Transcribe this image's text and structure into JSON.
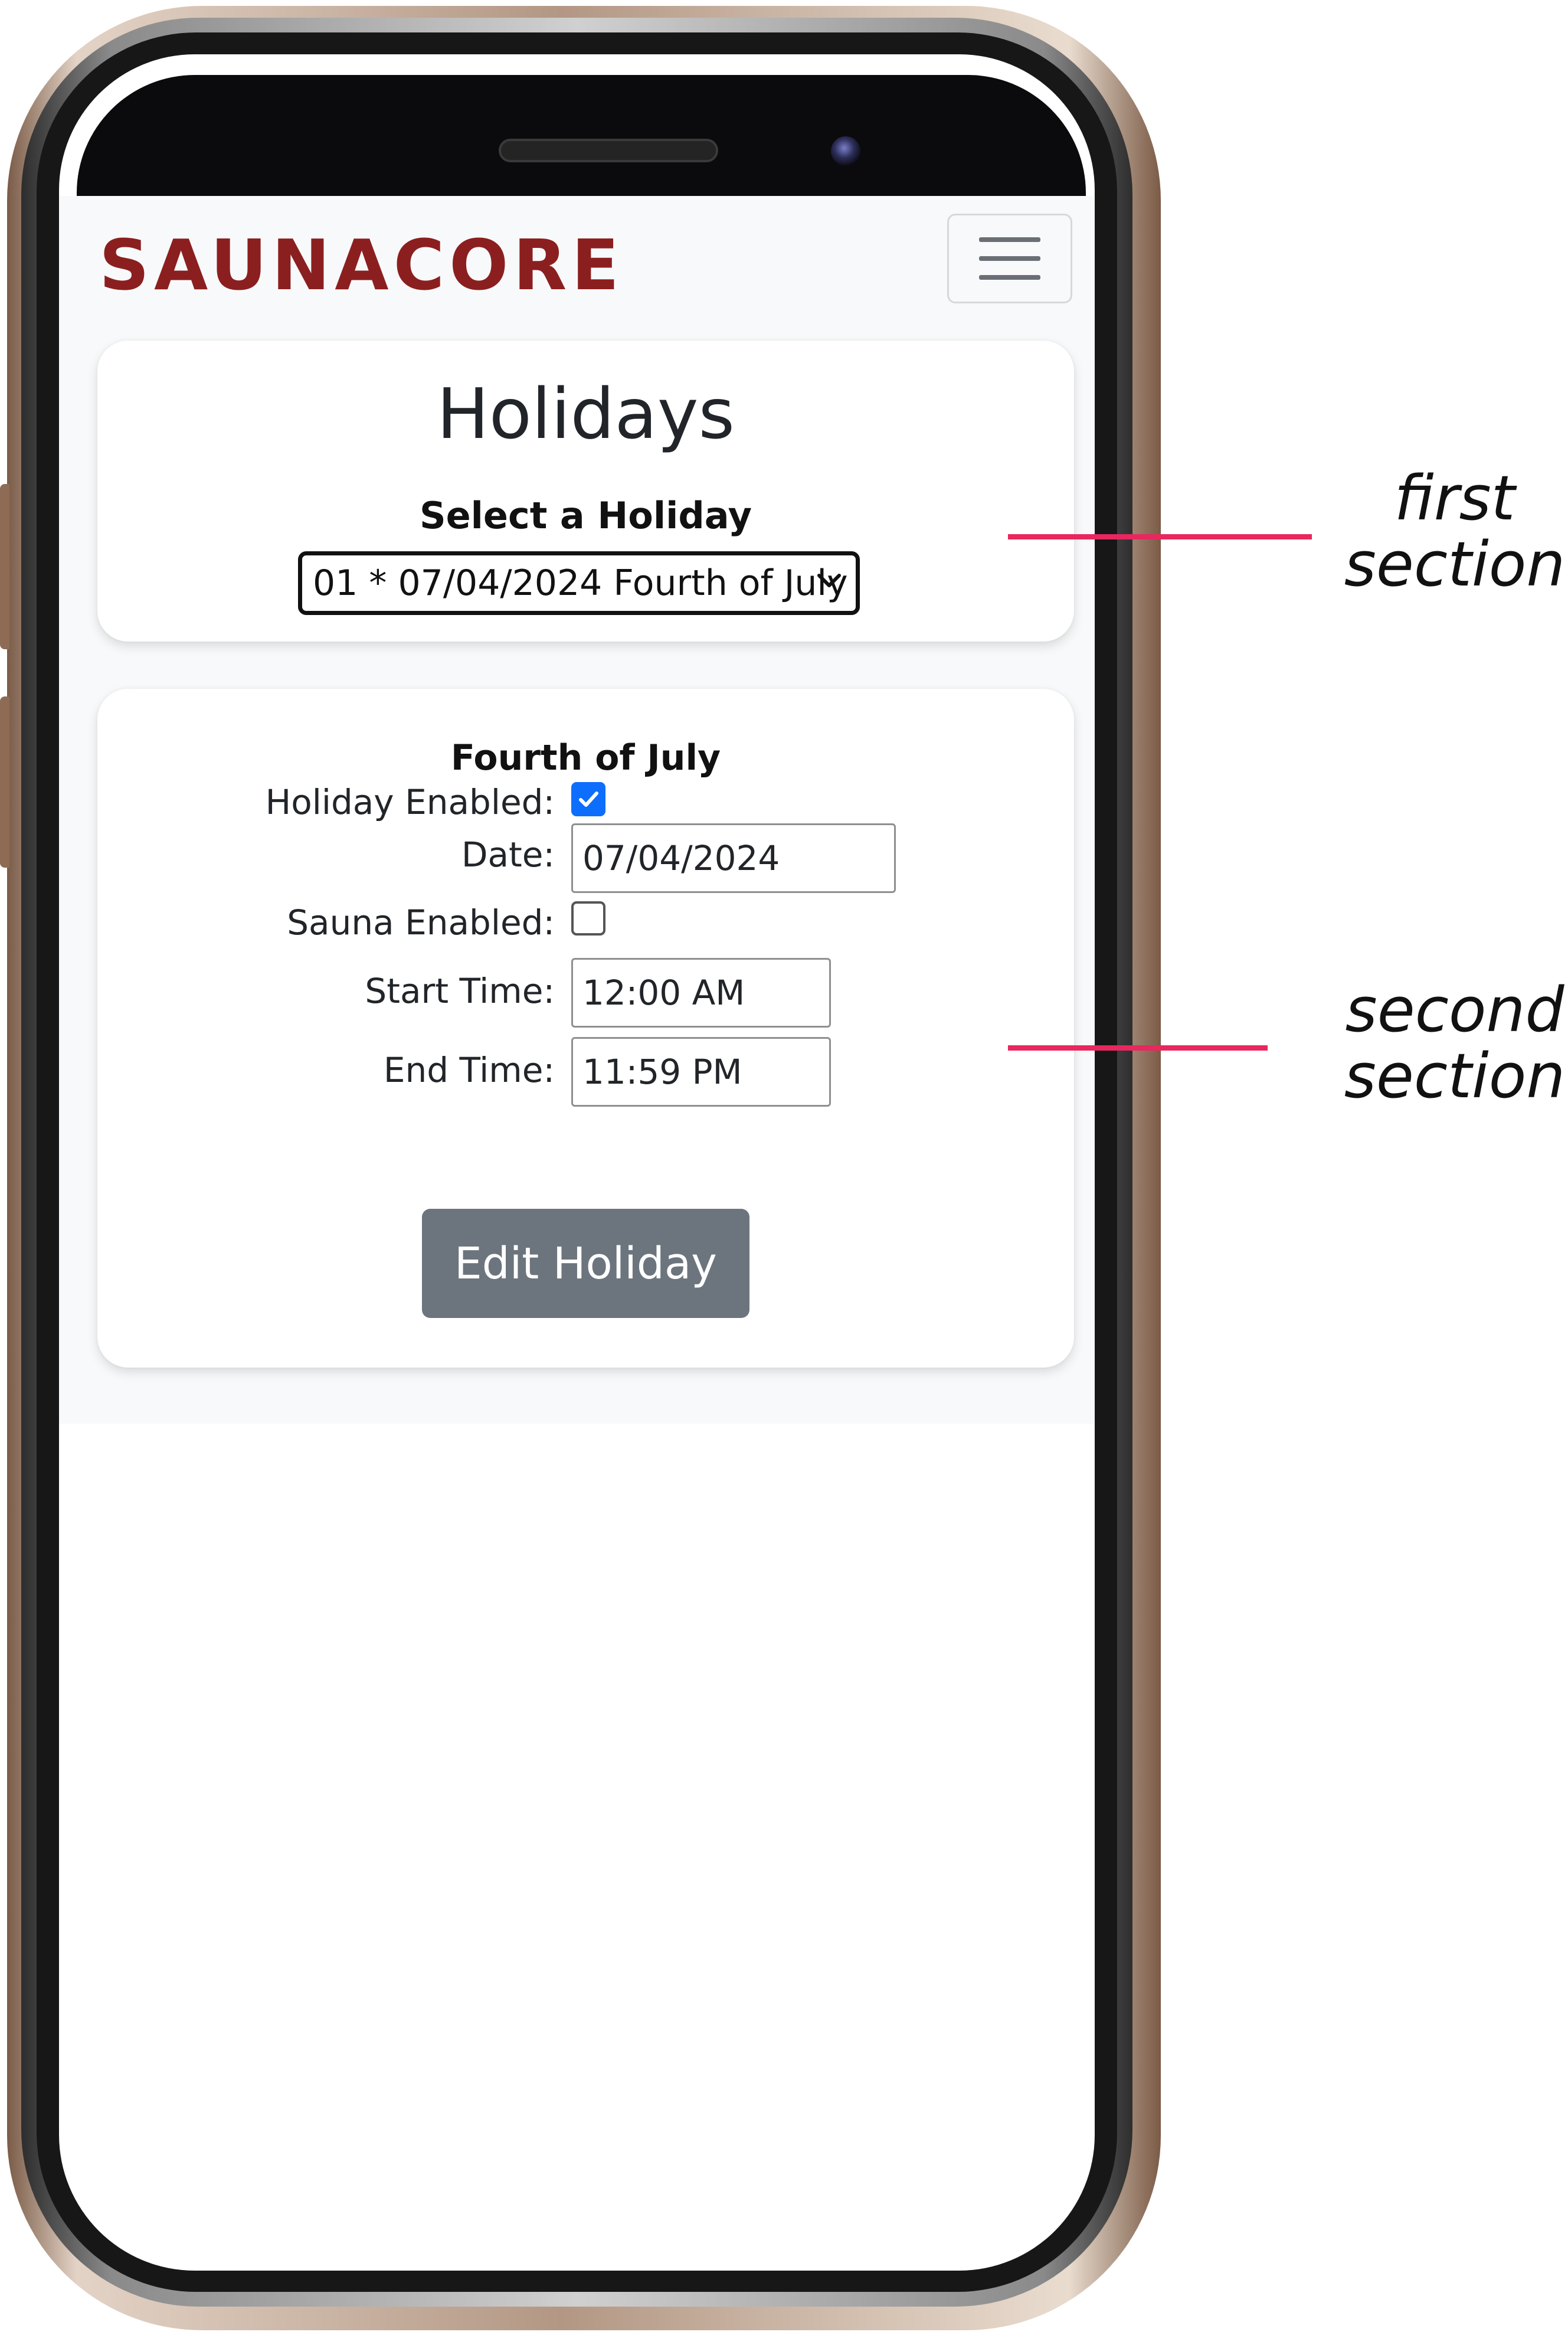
{
  "app": {
    "brand": "SAUNACORE",
    "brand_color": "#8b1f1f",
    "menu_icon": "hamburger-menu-icon"
  },
  "first_section": {
    "title": "Holidays",
    "select_label": "Select a Holiday",
    "selected_holiday": "01 * 07/04/2024 Fourth of July"
  },
  "second_section": {
    "holiday_name": "Fourth of July",
    "fields": {
      "holiday_enabled": {
        "label": "Holiday Enabled:",
        "checked": true
      },
      "date": {
        "label": "Date:",
        "value": "07/04/2024"
      },
      "sauna_enabled": {
        "label": "Sauna Enabled:",
        "checked": false
      },
      "start_time": {
        "label": "Start Time:",
        "value": "12:00 AM"
      },
      "end_time": {
        "label": "End Time:",
        "value": "11:59 PM"
      }
    },
    "edit_button_label": "Edit Holiday",
    "button_color": "#6c757d",
    "checkbox_color": "#0d6efd"
  },
  "annotations": {
    "first_section": [
      "first",
      "section"
    ],
    "second_section": [
      "second",
      "section"
    ],
    "line_color": "#e8275f"
  }
}
